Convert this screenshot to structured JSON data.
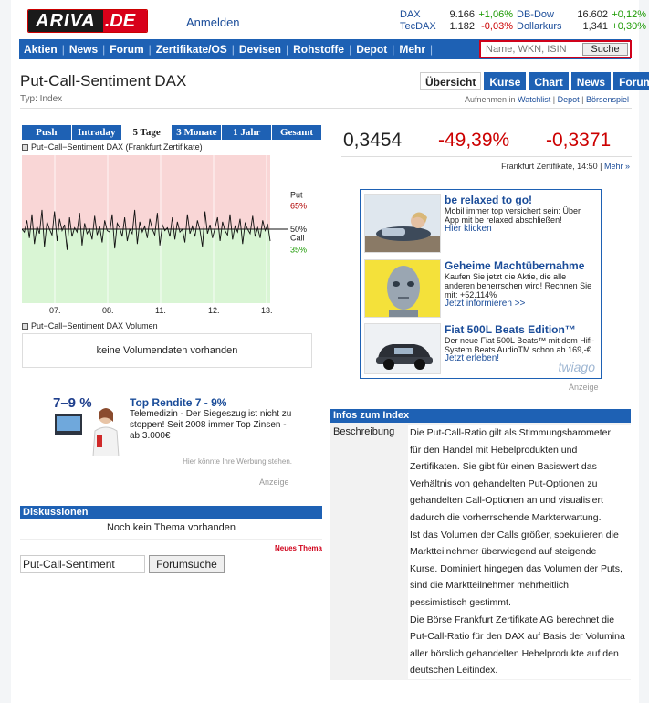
{
  "header": {
    "logo_a": "ARIVA",
    "logo_b": ".DE",
    "login": "Anmelden",
    "tickers": [
      {
        "name": "DAX",
        "value": "9.166",
        "change": "+1,06%",
        "neg": false,
        "name2": "DB-Dow",
        "value2": "16.602",
        "change2": "+0,12%",
        "neg2": false
      },
      {
        "name": "TecDAX",
        "value": "1.182",
        "change": "-0,03%",
        "neg": true,
        "name2": "Dollarkurs",
        "value2": "1,341",
        "change2": "+0,30%",
        "neg2": false
      }
    ]
  },
  "nav": {
    "items": [
      "Aktien",
      "News",
      "Forum",
      "Zertifikate/OS",
      "Devisen",
      "Rohstoffe",
      "Depot",
      "Mehr"
    ],
    "search_placeholder": "Name, WKN, ISIN",
    "search_button": "Suche"
  },
  "page": {
    "title": "Put-Call-Sentiment DAX",
    "typ": "Typ: Index",
    "tabs": [
      "Übersicht",
      "Kurse",
      "Chart",
      "News",
      "Forum"
    ],
    "watch_prefix": "Aufnehmen in",
    "watch_links": [
      "Watchlist",
      "Depot",
      "Börsenspiel"
    ]
  },
  "chart_panel": {
    "period_tabs": [
      "Push",
      "Intraday",
      "5 Tage",
      "3 Monate",
      "1 Jahr",
      "Gesamt"
    ],
    "active_period": 2,
    "legend": "Put−Call−Sentiment DAX (Frankfurt Zertifikate)",
    "volume_legend": "Put−Call−Sentiment DAX Volumen",
    "volume_empty": "keine Volumendaten vorhanden"
  },
  "chart_data": {
    "type": "line",
    "title": "Put−Call−Sentiment DAX (Frankfurt Zertifikate)",
    "x_ticks": [
      "07.",
      "08.",
      "11.",
      "12.",
      "13."
    ],
    "ylim": [
      0,
      100
    ],
    "put_label": "Put",
    "put_level": "65%",
    "mid_label": "50%",
    "call_label": "Call",
    "call_level": "35%",
    "put_value": 65,
    "mid_value": 50,
    "call_value": 35,
    "colors": {
      "put_zone": "#f9d6d6",
      "call_zone": "#d9f5d4",
      "line": "#111111",
      "put_text": "#b00000",
      "call_text": "#1a9900"
    },
    "values": [
      50,
      48,
      56,
      44,
      60,
      40,
      52,
      47,
      63,
      38,
      55,
      50,
      46,
      62,
      42,
      57,
      49,
      53,
      36,
      58,
      45,
      51,
      48,
      61,
      39,
      54,
      47,
      50,
      43,
      59,
      46,
      52,
      41,
      56,
      49,
      48,
      60,
      37,
      54,
      51,
      45,
      58,
      42,
      50,
      47,
      63,
      40,
      55,
      48,
      52,
      44,
      57,
      50,
      46,
      61,
      39,
      53,
      49,
      51,
      45,
      58,
      43,
      55,
      48,
      50,
      41,
      60,
      47,
      52,
      45,
      56,
      49,
      38,
      62,
      47,
      53,
      44,
      51,
      58,
      42,
      55,
      49,
      46,
      60,
      43,
      52,
      48,
      57,
      40,
      54,
      50,
      47,
      59,
      45,
      51,
      44,
      56,
      49,
      53,
      42
    ]
  },
  "quote": {
    "price": "0,3454",
    "change_pct": "-49,39%",
    "change_abs": "-0,3371",
    "meta": "Frankfurt Zertifikate, 14:50",
    "meta_link": "Mehr »"
  },
  "ads_right": {
    "items": [
      {
        "title": "be relaxed to go!",
        "text": "Mobil immer top versichert sein: Über App mit be relaxed abschließen!",
        "link": "Hier klicken"
      },
      {
        "title": "Geheime Machtübernahme",
        "text": "Kaufen Sie jetzt die Aktie, die alle anderen beherrschen wird! Rechnen Sie mit: +52.114%",
        "link": "Jetzt informieren >>"
      },
      {
        "title": "Fiat 500L Beats Edition™",
        "text": "Der neue Fiat 500L Beats™ mit dem Hifi-System Beats AudioTM schon ab 169,-€",
        "link": "Jetzt erleben!"
      }
    ],
    "brand": "twiago",
    "anzeige": "Anzeige"
  },
  "promo_left": {
    "badge": "7–9 %",
    "title": "Top Rendite 7 - 9%",
    "text": "Telemedizin - Der Siegeszug ist nicht zu stoppen! Seit 2008 immer Top Zinsen - ab 3.000€",
    "note": "Hier könnte Ihre Werbung stehen.",
    "anzeige": "Anzeige"
  },
  "discussions": {
    "heading": "Diskussionen",
    "empty": "Noch kein Thema vorhanden",
    "new_topic": "Neues Thema",
    "search_value": "Put-Call-Sentiment",
    "search_button": "Forumsuche"
  },
  "infos": {
    "heading": "Infos zum Index",
    "label": "Beschreibung",
    "lines": [
      "Die Put-Call-Ratio gilt als Stimmungsbarometer",
      "für den Handel mit Hebelprodukten und",
      "Zertifikaten. Sie gibt für einen Basiswert das",
      "Verhältnis von gehandelten Put-Optionen zu",
      "gehandelten Call-Optionen an und visualisiert",
      "dadurch die vorherrschende Markterwartung.",
      "Ist das Volumen der Calls größer, spekulieren die",
      "Marktteilnehmer überwiegend auf steigende",
      "Kurse. Dominiert hingegen das Volumen der Puts,",
      "sind die Marktteilnehmer mehrheitlich",
      "pessimistisch gestimmt.",
      "Die Börse Frankfurt Zertifikate AG berechnet die",
      "Put-Call-Ratio für den DAX auf Basis der Volumina",
      "aller börslich gehandelten Hebelprodukte auf den",
      "deutschen Leitindex."
    ]
  }
}
